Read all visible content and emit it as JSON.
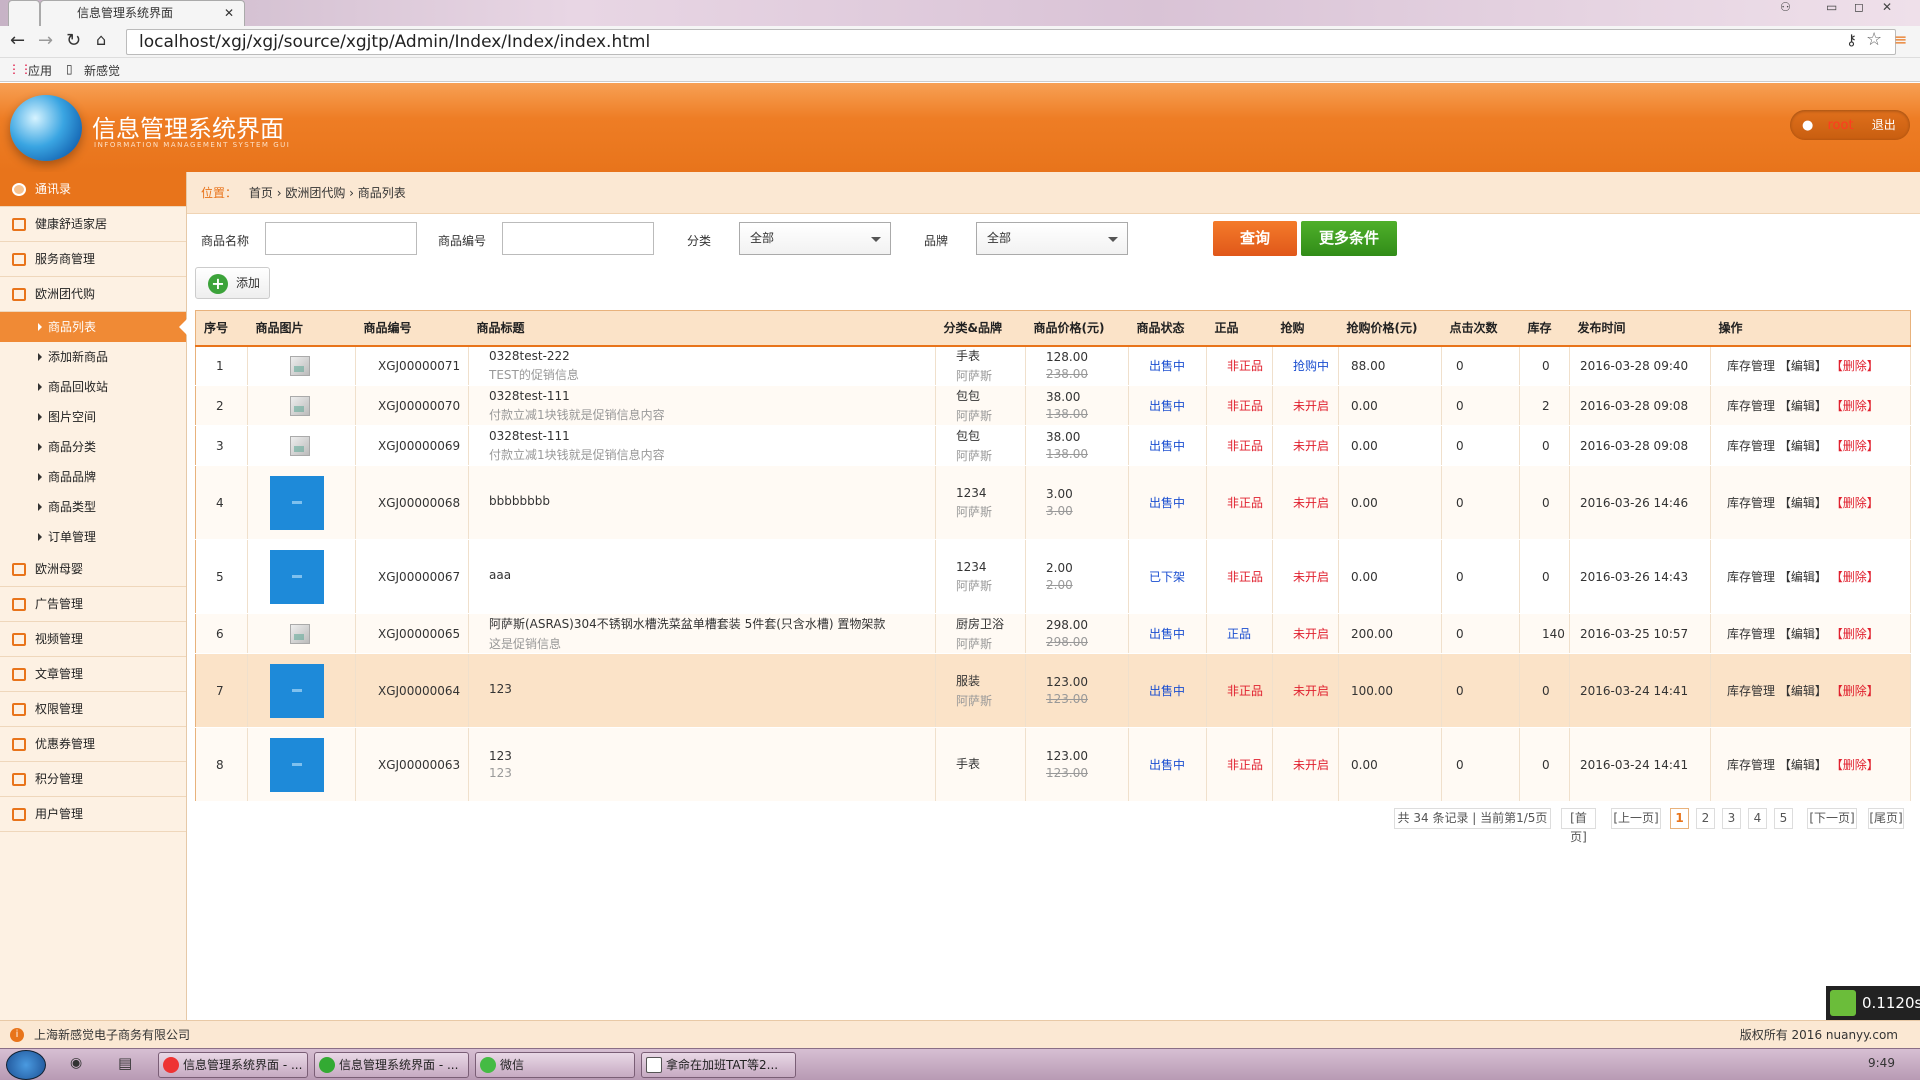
{
  "browser": {
    "tab_title": "信息管理系统界面",
    "url": "localhost/xgj/xgj/source/xgjtp/Admin/Index/Index/index.html",
    "bookmarks": [
      "应用",
      "新感觉"
    ]
  },
  "header": {
    "title": "信息管理系统界面",
    "subtitle": "INFORMATION MANAGEMENT SYSTEM GUI",
    "username": "root",
    "logout": "退出"
  },
  "sidebar": {
    "top": "通讯录",
    "groups": [
      "健康舒适家居",
      "服务商管理",
      "欧洲团代购"
    ],
    "subitems": [
      "商品列表",
      "添加新商品",
      "商品回收站",
      "图片空间",
      "商品分类",
      "商品品牌",
      "商品类型",
      "订单管理"
    ],
    "groups2": [
      "欧洲母婴",
      "广告管理",
      "视频管理",
      "文章管理",
      "权限管理",
      "优惠券管理",
      "积分管理",
      "用户管理"
    ]
  },
  "crumb": {
    "label": "位置：",
    "items": [
      "首页",
      "欧洲团代购",
      "商品列表"
    ]
  },
  "filters": {
    "name_label": "商品名称",
    "code_label": "商品编号",
    "cat_label": "分类",
    "cat_value": "全部",
    "brand_label": "品牌",
    "brand_value": "全部",
    "search": "查询",
    "more": "更多条件",
    "add": "添加"
  },
  "table": {
    "headers": [
      "序号",
      "商品图片",
      "商品编号",
      "商品标题",
      "分类&品牌",
      "商品价格(元)",
      "商品状态",
      "正品",
      "抢购",
      "抢购价格(元)",
      "点击次数",
      "库存",
      "发布时间",
      "操作"
    ],
    "rows": [
      {
        "no": "1",
        "img": "small",
        "code": "XGJ00000071",
        "title": "0328test-222",
        "promo": "TEST的促销信息",
        "cat": "手表",
        "brand": "阿萨斯",
        "price": "128.00",
        "orig": "238.00",
        "status": "出售中",
        "genuine": "非正品",
        "rush": "抢购中",
        "rush_price": "88.00",
        "clicks": "0",
        "stock": "0",
        "time": "2016-03-28 09:40"
      },
      {
        "no": "2",
        "img": "small",
        "code": "XGJ00000070",
        "title": "0328test-111",
        "promo": "付款立减1块钱就是促销信息内容",
        "cat": "包包",
        "brand": "阿萨斯",
        "price": "38.00",
        "orig": "138.00",
        "status": "出售中",
        "genuine": "非正品",
        "rush": "未开启",
        "rush_price": "0.00",
        "clicks": "0",
        "stock": "2",
        "time": "2016-03-28 09:08"
      },
      {
        "no": "3",
        "img": "small",
        "code": "XGJ00000069",
        "title": "0328test-111",
        "promo": "付款立减1块钱就是促销信息内容",
        "cat": "包包",
        "brand": "阿萨斯",
        "price": "38.00",
        "orig": "138.00",
        "status": "出售中",
        "genuine": "非正品",
        "rush": "未开启",
        "rush_price": "0.00",
        "clicks": "0",
        "stock": "0",
        "time": "2016-03-28 09:08"
      },
      {
        "no": "4",
        "img": "big",
        "code": "XGJ00000068",
        "title": "bbbbbbbb",
        "promo": "",
        "cat": "1234",
        "brand": "阿萨斯",
        "price": "3.00",
        "orig": "3.00",
        "status": "出售中",
        "genuine": "非正品",
        "rush": "未开启",
        "rush_price": "0.00",
        "clicks": "0",
        "stock": "0",
        "time": "2016-03-26 14:46"
      },
      {
        "no": "5",
        "img": "big",
        "code": "XGJ00000067",
        "title": "aaa",
        "promo": "",
        "cat": "1234",
        "brand": "阿萨斯",
        "price": "2.00",
        "orig": "2.00",
        "status": "已下架",
        "genuine": "非正品",
        "rush": "未开启",
        "rush_price": "0.00",
        "clicks": "0",
        "stock": "0",
        "time": "2016-03-26 14:43"
      },
      {
        "no": "6",
        "img": "small",
        "code": "XGJ00000065",
        "title": "阿萨斯(ASRAS)304不锈钢水槽洗菜盆单槽套装 5件套(只含水槽) 置物架款",
        "promo": "这是促销信息",
        "cat": "厨房卫浴",
        "brand": "阿萨斯",
        "price": "298.00",
        "orig": "298.00",
        "status": "出售中",
        "genuine": "正品",
        "rush": "未开启",
        "rush_price": "200.00",
        "clicks": "0",
        "stock": "140",
        "time": "2016-03-25 10:57"
      },
      {
        "no": "7",
        "img": "big",
        "code": "XGJ00000064",
        "title": "123",
        "promo": "",
        "cat": "服装",
        "brand": "阿萨斯",
        "price": "123.00",
        "orig": "123.00",
        "status": "出售中",
        "genuine": "非正品",
        "rush": "未开启",
        "rush_price": "100.00",
        "clicks": "0",
        "stock": "0",
        "time": "2016-03-24 14:41"
      },
      {
        "no": "8",
        "img": "big",
        "code": "XGJ00000063",
        "title": "123",
        "promo": "123",
        "cat": "手表",
        "brand": "",
        "price": "123.00",
        "orig": "123.00",
        "status": "出售中",
        "genuine": "非正品",
        "rush": "未开启",
        "rush_price": "0.00",
        "clicks": "0",
        "stock": "0",
        "time": "2016-03-24 14:41"
      }
    ],
    "ops": [
      "库存管理",
      "【编辑】",
      "【删除】"
    ]
  },
  "pager": {
    "summary": "共 34 条记录 | 当前第1/5页",
    "first": "[首页]",
    "prev": "[上一页]",
    "pages": [
      "1",
      "2",
      "3",
      "4",
      "5"
    ],
    "next": "[下一页]",
    "last": "[尾页]"
  },
  "footer": {
    "company": "上海新感觉电子商务有限公司",
    "copyright": "版权所有 2016 nuanyy.com"
  },
  "timer": "0.1120s",
  "taskbar": {
    "items": [
      "信息管理系统界面 - ...",
      "信息管理系统界面 - ...",
      "微信",
      "拿命在加班TAT等2..."
    ],
    "clock": "9:49"
  },
  "colors": {
    "accent": "#e8741b",
    "search_btn": "#e8601b",
    "more_btn": "#3c9a1f",
    "blue": "#1a4ed0",
    "red": "#e0202e"
  }
}
